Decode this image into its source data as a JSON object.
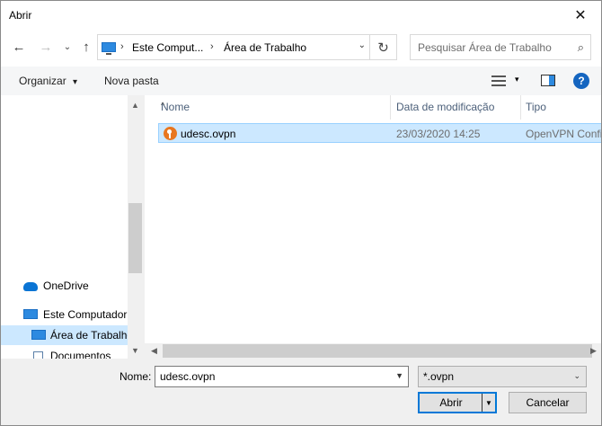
{
  "window": {
    "title": "Abrir",
    "close_glyph": "✕"
  },
  "nav": {
    "back_glyph": "←",
    "forward_glyph": "→",
    "recent_glyph": "⌄",
    "up_glyph": "↑",
    "breadcrumb": [
      "Este Comput...",
      "Área de Trabalho"
    ],
    "breadcrumb_sep": "›",
    "dropdown_glyph": "⌄",
    "refresh_glyph": "↻",
    "search_placeholder": "Pesquisar Área de Trabalho",
    "search_glyph": "⌕"
  },
  "commands": {
    "organize_label": "Organizar",
    "organize_drop": "▾",
    "new_folder_label": "Nova pasta",
    "view_drop": "▾",
    "help_label": "?"
  },
  "sidebar": {
    "items": [
      {
        "label": "OneDrive",
        "icon": "onedrive-icon"
      },
      {
        "label": "Este Computador",
        "icon": "pc-icon"
      },
      {
        "label": "Área de Trabalho",
        "icon": "desktop-icon",
        "selected": true
      },
      {
        "label": "Documentos",
        "icon": "documents-icon"
      }
    ],
    "scroll_up_glyph": "▲",
    "scroll_down_glyph": "▼"
  },
  "files": {
    "columns": [
      "Nome",
      "Data de modificação",
      "Tipo"
    ],
    "sort_glyph": "^",
    "rows": [
      {
        "name": "udesc.ovpn",
        "modified": "23/03/2020 14:25",
        "type": "OpenVPN Confi",
        "icon": "openvpn-icon"
      }
    ],
    "scroll_left_glyph": "◀",
    "scroll_right_glyph": "▶"
  },
  "footer": {
    "name_label": "Nome:",
    "name_value": "udesc.ovpn",
    "name_drop": "▼",
    "filter_value": "*.ovpn",
    "filter_drop": "⌄",
    "open_label": "Abrir",
    "open_split_glyph": "▼",
    "cancel_label": "Cancelar"
  },
  "colors": {
    "selection": "#cce8ff",
    "accent": "#0078d7",
    "openvpn_orange": "#e8761f"
  }
}
